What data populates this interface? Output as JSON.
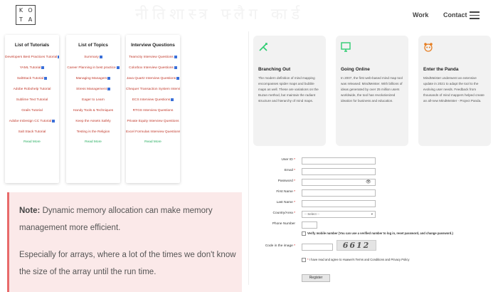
{
  "header": {
    "logo_letters": [
      "K",
      "O",
      "T",
      "A"
    ],
    "nav": {
      "work": "Work",
      "contact": "Contact"
    },
    "watermark": "नीतिशास्त्र फ्लैग कार्ड"
  },
  "tutorial_cards": [
    {
      "title": "List of Tutorials",
      "items": [
        {
          "label": "Developers Best Practices Tutorial",
          "badge": true
        },
        {
          "label": "YAML Tutorial",
          "badge": true
        },
        {
          "label": "SaltStack Tutorial",
          "badge": true
        },
        {
          "label": "Adobe Robohelp Tutorial",
          "badge": false
        },
        {
          "label": "Sublime Text Tutorial",
          "badge": false
        },
        {
          "label": "Grails Tutorial",
          "badge": false
        },
        {
          "label": "Adobe InDesign CC Tutorial",
          "badge": true
        },
        {
          "label": "Salt Stack Tutorial",
          "badge": false
        }
      ],
      "read_more": "Read More"
    },
    {
      "title": "List of Topics",
      "items": [
        {
          "label": "Summary",
          "badge": true
        },
        {
          "label": "Career Planning in best practice",
          "badge": true
        },
        {
          "label": "Managing Managers",
          "badge": true
        },
        {
          "label": "Stress Management",
          "badge": true
        },
        {
          "label": "Eager to Learn",
          "badge": false
        },
        {
          "label": "Handy Tools & Techniques",
          "badge": false
        },
        {
          "label": "Keep the Assets Safely",
          "badge": false
        },
        {
          "label": "Testing is the Religion",
          "badge": false
        }
      ],
      "read_more": "Read More"
    },
    {
      "title": "Interview Questions",
      "items": [
        {
          "label": "Teamcity Interview Questions",
          "badge": true
        },
        {
          "label": "Colorbox Interview Questions",
          "badge": true
        },
        {
          "label": "Java Quartz Interview Questions",
          "badge": true
        },
        {
          "label": "Chequer Transaction System Interview Questions",
          "badge": true
        },
        {
          "label": "ECS Interview Questions",
          "badge": true
        },
        {
          "label": "RTGS Interview Questions",
          "badge": false
        },
        {
          "label": "Private Equity Interview Questions",
          "badge": false
        },
        {
          "label": "Excel Formulas Interview Questions",
          "badge": false
        }
      ],
      "read_more": "Read More"
    }
  ],
  "note": {
    "prefix": "Note:",
    "line1": " Dynamic memory allocation can make memory management more efficient.",
    "line2": "Especially for arrays, where a lot of the times we don't know the size of the array until the run time."
  },
  "feature_cards": [
    {
      "icon": "branching-icon",
      "icon_color": "#2ecc71",
      "title": "Branching Out",
      "text": "The modern definition of mind mapping encompasses spider maps and bubble maps as well. These are variations on the Buzan method, but maintain the radiant structure and hierarchy of mind maps."
    },
    {
      "icon": "monitor-icon",
      "icon_color": "#2ecc71",
      "title": "Going Online",
      "text": "In 2007, the first web-based mind map tool was released: MindMeister. With billions of ideas generated by over 25 million users worldwide, the tool has revolutionized ideation for business and education."
    },
    {
      "icon": "panda-icon",
      "icon_color": "#e67e22",
      "title": "Enter the Panda",
      "text": "MindMeister underwent an extensive update in 2021 to adapt the tool to the evolving user needs. Feedback from thousands of mind mappers helped create an all-new MindMeister - Project Panda."
    }
  ],
  "form": {
    "fields": [
      {
        "label": "User ID",
        "required": true,
        "type": "text",
        "value": ""
      },
      {
        "label": "Email",
        "required": true,
        "type": "text",
        "value": ""
      },
      {
        "label": "Password",
        "required": true,
        "type": "password",
        "value": ""
      },
      {
        "label": "First Name",
        "required": true,
        "type": "text",
        "value": ""
      },
      {
        "label": "Last Name",
        "required": true,
        "type": "text",
        "value": ""
      },
      {
        "label": "Country/Area",
        "required": true,
        "type": "select",
        "value": "-- Select --"
      },
      {
        "label": "Phone Number",
        "required": false,
        "type": "phone",
        "value": ""
      }
    ],
    "verify_mobile_text": "Verify mobile number (You can use a verified number to log in, reset password, and change password.)",
    "captcha_label": "Code in the image",
    "captcha_text": "6612",
    "agree_text": "I have read and agree to Huawei's Terms and Conditions and Privacy Policy",
    "register_label": "Register"
  }
}
